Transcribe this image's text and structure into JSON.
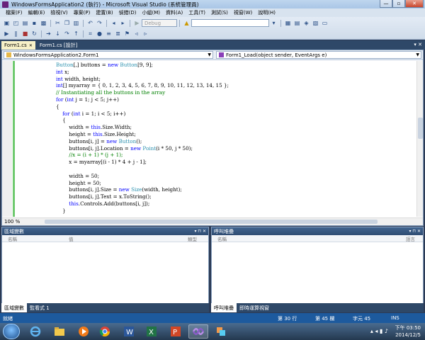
{
  "window": {
    "title": "WindowsFormsApplication2 (執行) - Microsoft Visual Studio (系統管理員)",
    "controls": [
      "—",
      "▫",
      "✕"
    ]
  },
  "menu": [
    "檔案(F)",
    "編輯(E)",
    "檢視(V)",
    "專案(P)",
    "建置(B)",
    "偵錯(D)",
    "小組(M)",
    "資料(A)",
    "工具(T)",
    "測試(S)",
    "視窗(W)",
    "說明(H)"
  ],
  "toolbar": {
    "config": "Debug",
    "platform": ""
  },
  "doc_tabs": [
    {
      "label": "Form1.cs",
      "active": true
    },
    {
      "label": "Form1.cs [設計]",
      "active": false
    }
  ],
  "editor": {
    "class_combo": "WindowsFormsApplication2.Form1",
    "member_combo": "Form1_Load(object sender, EventArgs e)",
    "zoom": "100 %",
    "lines": [
      {
        "indent": 0,
        "tokens": [
          {
            "t": "ty",
            "s": "Button"
          },
          {
            "t": "",
            "s": "[,] buttons = "
          },
          {
            "t": "kw",
            "s": "new"
          },
          {
            "t": "",
            "s": " "
          },
          {
            "t": "ty",
            "s": "Button"
          },
          {
            "t": "",
            "s": "[9, 9];"
          }
        ]
      },
      {
        "indent": 0,
        "tokens": [
          {
            "t": "kw",
            "s": "int"
          },
          {
            "t": "",
            "s": " x;"
          }
        ]
      },
      {
        "indent": 0,
        "tokens": [
          {
            "t": "kw",
            "s": "int"
          },
          {
            "t": "",
            "s": " width, height;"
          }
        ]
      },
      {
        "indent": 0,
        "tokens": [
          {
            "t": "kw",
            "s": "int"
          },
          {
            "t": "",
            "s": "[] myarray = { 0, 1, 2, 3, 4, 5, 6, 7, 8, 9, 10, 11, 12, 13, 14, 15 };"
          }
        ]
      },
      {
        "indent": 0,
        "tokens": [
          {
            "t": "cm",
            "s": "// Instantiating all the buttons in the array"
          }
        ]
      },
      {
        "indent": 0,
        "tokens": [
          {
            "t": "kw",
            "s": "for"
          },
          {
            "t": "",
            "s": " ("
          },
          {
            "t": "kw",
            "s": "int"
          },
          {
            "t": "",
            "s": " j = 1; j < 5; j++)"
          }
        ]
      },
      {
        "indent": 0,
        "tokens": [
          {
            "t": "",
            "s": "{"
          }
        ]
      },
      {
        "indent": 1,
        "tokens": [
          {
            "t": "kw",
            "s": "for"
          },
          {
            "t": "",
            "s": " ("
          },
          {
            "t": "kw",
            "s": "int"
          },
          {
            "t": "",
            "s": " i = 1; i < 5; i++)"
          }
        ]
      },
      {
        "indent": 1,
        "tokens": [
          {
            "t": "",
            "s": "{"
          }
        ]
      },
      {
        "indent": 2,
        "tokens": [
          {
            "t": "",
            "s": "width = "
          },
          {
            "t": "kw",
            "s": "this"
          },
          {
            "t": "",
            "s": ".Size.Width;"
          }
        ]
      },
      {
        "indent": 2,
        "tokens": [
          {
            "t": "",
            "s": "height = "
          },
          {
            "t": "kw",
            "s": "this"
          },
          {
            "t": "",
            "s": ".Size.Height;"
          }
        ]
      },
      {
        "indent": 2,
        "tokens": [
          {
            "t": "",
            "s": "buttons[i, j] = "
          },
          {
            "t": "kw",
            "s": "new"
          },
          {
            "t": "",
            "s": " "
          },
          {
            "t": "ty",
            "s": "Button"
          },
          {
            "t": "",
            "s": "();"
          }
        ]
      },
      {
        "indent": 2,
        "tokens": [
          {
            "t": "",
            "s": "buttons[i, j].Location = "
          },
          {
            "t": "kw",
            "s": "new"
          },
          {
            "t": "",
            "s": " "
          },
          {
            "t": "ty",
            "s": "Point"
          },
          {
            "t": "",
            "s": "(i * 50, j * 50);"
          }
        ]
      },
      {
        "indent": 2,
        "tokens": [
          {
            "t": "cm",
            "s": "//x = (i + 1) * (j + 1);"
          }
        ]
      },
      {
        "indent": 2,
        "tokens": [
          {
            "t": "",
            "s": "x = myarray[(i - 1) * 4 + j - 1];"
          }
        ]
      },
      {
        "indent": 2,
        "tokens": [
          {
            "t": "",
            "s": ""
          }
        ]
      },
      {
        "indent": 2,
        "tokens": [
          {
            "t": "",
            "s": "width = 50;"
          }
        ]
      },
      {
        "indent": 2,
        "tokens": [
          {
            "t": "",
            "s": "height = 50;"
          }
        ]
      },
      {
        "indent": 2,
        "tokens": [
          {
            "t": "",
            "s": "buttons[i, j].Size = "
          },
          {
            "t": "kw",
            "s": "new"
          },
          {
            "t": "",
            "s": " "
          },
          {
            "t": "ty",
            "s": "Size"
          },
          {
            "t": "",
            "s": "(width, height);"
          }
        ]
      },
      {
        "indent": 2,
        "tokens": [
          {
            "t": "",
            "s": "buttons[i, j].Text = x.ToString();"
          }
        ]
      },
      {
        "indent": 2,
        "tokens": [
          {
            "t": "kw",
            "s": "this"
          },
          {
            "t": "",
            "s": ".Controls.Add(buttons[i, j]);"
          }
        ]
      },
      {
        "indent": 1,
        "tokens": [
          {
            "t": "",
            "s": "}"
          }
        ]
      }
    ]
  },
  "locals_panel": {
    "title": "區域變數",
    "columns": [
      "名稱",
      "值",
      "類型"
    ],
    "tabs": [
      {
        "label": "區域變數",
        "active": true
      },
      {
        "label": "監看式 1",
        "active": false
      }
    ]
  },
  "callstack_panel": {
    "title": "呼叫堆疊",
    "columns": [
      "名稱",
      "語言"
    ],
    "tabs": [
      {
        "label": "呼叫堆疊",
        "active": true
      },
      {
        "label": "即時運算視窗",
        "active": false
      }
    ]
  },
  "panel_controls": "▾ ⊓ ✕",
  "status": {
    "state": "就緒",
    "line": "第 30 行",
    "col": "第 45 欄",
    "ch": "字元 45",
    "mode": "INS"
  },
  "taskbar": {
    "time": "下午 03:50",
    "date": "2014/12/5",
    "tray_icons": "▴ ◂ ▮ ♪"
  },
  "colors": {
    "keyword": "#0000ff",
    "type": "#2b91af",
    "comment": "#008000",
    "status_bar": "#1d5a9e"
  }
}
